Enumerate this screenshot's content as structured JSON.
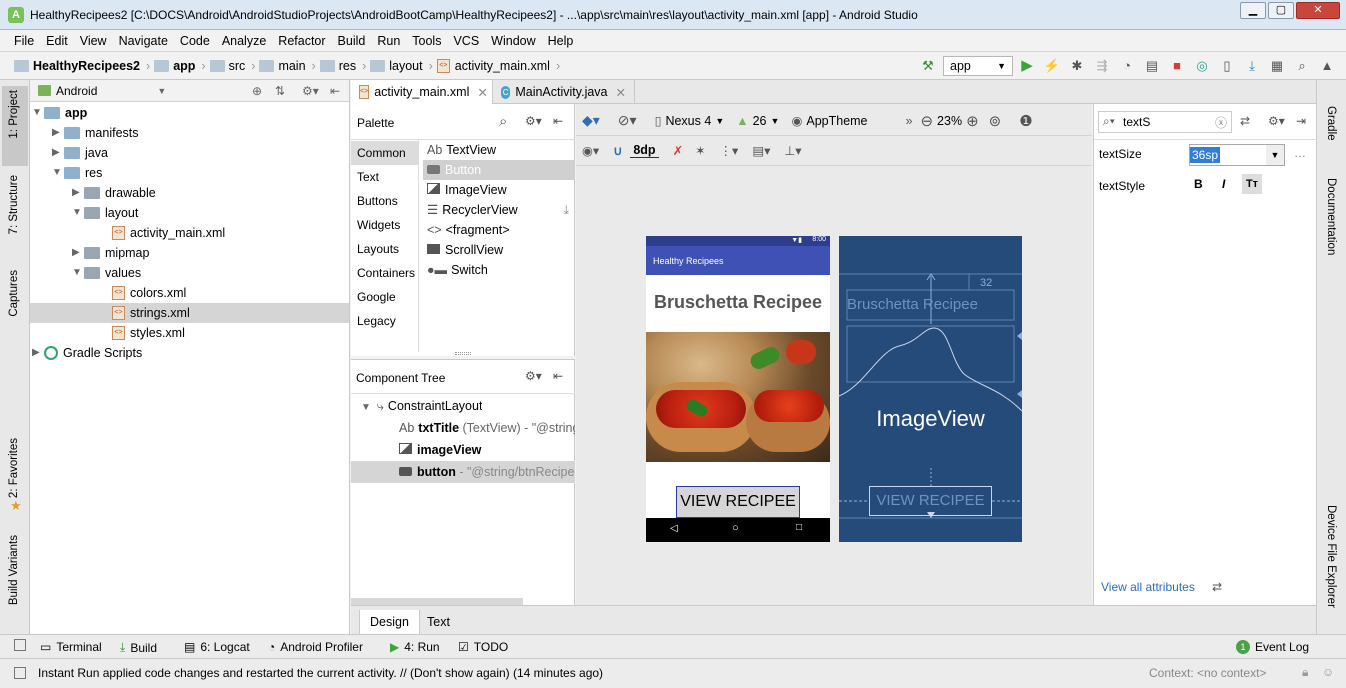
{
  "window": {
    "title": "HealthyRecipees2 [C:\\DOCS\\Android\\AndroidStudioProjects\\AndroidBootCamp\\HealthyRecipees2] - ...\\app\\src\\main\\res\\layout\\activity_main.xml [app] - Android Studio"
  },
  "menu": [
    "File",
    "Edit",
    "View",
    "Navigate",
    "Code",
    "Analyze",
    "Refactor",
    "Build",
    "Run",
    "Tools",
    "VCS",
    "Window",
    "Help"
  ],
  "breadcrumbs": [
    "HealthyRecipees2",
    "app",
    "src",
    "main",
    "res",
    "layout",
    "activity_main.xml"
  ],
  "toolbar": {
    "config": "app"
  },
  "left_strip": {
    "project": "1: Project",
    "structure": "7: Structure",
    "captures": "Captures",
    "favorites": "2: Favorites",
    "build_variants": "Build Variants"
  },
  "right_strip": {
    "gradle": "Gradle",
    "documentation": "Documentation",
    "device_file_explorer": "Device File Explorer"
  },
  "project": {
    "view": "Android",
    "tree": [
      {
        "label": "app",
        "bold": true
      },
      {
        "label": "manifests"
      },
      {
        "label": "java"
      },
      {
        "label": "res"
      },
      {
        "label": "drawable"
      },
      {
        "label": "layout"
      },
      {
        "label": "activity_main.xml"
      },
      {
        "label": "mipmap"
      },
      {
        "label": "values"
      },
      {
        "label": "colors.xml"
      },
      {
        "label": "strings.xml"
      },
      {
        "label": "styles.xml"
      },
      {
        "label": "Gradle Scripts"
      }
    ]
  },
  "editor_tabs": [
    "activity_main.xml",
    "MainActivity.java"
  ],
  "palette": {
    "title": "Palette",
    "categories": [
      "Common",
      "Text",
      "Buttons",
      "Widgets",
      "Layouts",
      "Containers",
      "Google",
      "Legacy"
    ],
    "items": [
      {
        "icon": "Ab",
        "label": "TextView"
      },
      {
        "icon": "",
        "label": "Button"
      },
      {
        "icon": "",
        "label": "ImageView"
      },
      {
        "icon": "",
        "label": "RecyclerView"
      },
      {
        "icon": "<>",
        "label": "<fragment>"
      },
      {
        "icon": "",
        "label": "ScrollView"
      },
      {
        "icon": "",
        "label": "Switch"
      }
    ]
  },
  "component_tree": {
    "title": "Component Tree",
    "root": "ConstraintLayout",
    "rows": [
      {
        "name": "txtTitle",
        "detail": " (TextView) - \"@string"
      },
      {
        "name": "imageView",
        "detail": ""
      },
      {
        "name": "button",
        "detail": " - \"@string/btnRecipee"
      }
    ]
  },
  "design_toolbar": {
    "device": "Nexus 4",
    "api": "26",
    "theme": "AppTheme",
    "zoom": "23%",
    "margin": "8dp"
  },
  "phone": {
    "status_time": "8:00",
    "app_title": "Healthy Recipees",
    "heading": "Bruschetta Recipee",
    "button": "VIEW RECIPEE"
  },
  "blueprint": {
    "heading": "Bruschetta Recipee",
    "image_label": "ImageView",
    "button": "VIEW RECIPEE",
    "margin": "32"
  },
  "attributes": {
    "search": "textS",
    "rows": [
      {
        "name": "textSize",
        "value": "36sp"
      },
      {
        "name": "textStyle",
        "value": ""
      }
    ],
    "view_all": "View all attributes"
  },
  "bottom_tabs": [
    "Design",
    "Text"
  ],
  "tool_windows": [
    "Terminal",
    "Build",
    "6: Logcat",
    "Android Profiler",
    "4: Run",
    "TODO",
    "Event Log"
  ],
  "event_count": "1",
  "status": {
    "message": "Instant Run applied code changes and restarted the current activity. // (Don't show again) (14 minutes ago)",
    "context": "Context: <no context>"
  }
}
